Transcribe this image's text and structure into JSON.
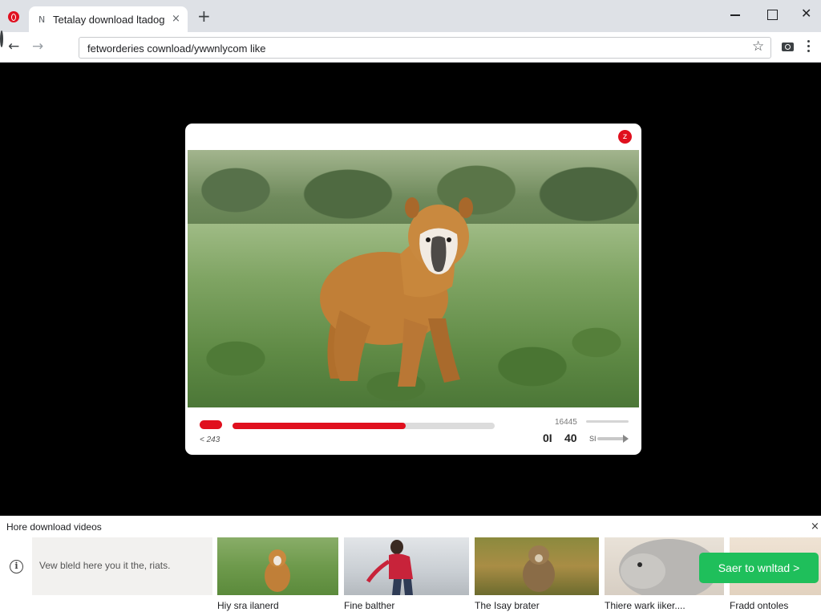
{
  "browser": {
    "tab_favicon": "N",
    "tab_title": "Tetalay download ltadog",
    "tab_close": "×",
    "new_tab": "+",
    "url": "fetworderies cownload/ywwnlycom like",
    "icons": [
      "app-logo-icon",
      "close-icon",
      "plus-icon",
      "minimize-icon",
      "maximize-icon",
      "back-arrow-icon",
      "forward-arrow-icon",
      "reload-icon",
      "star-icon",
      "camera-icon",
      "kebab-menu-icon"
    ],
    "window_close": "✕"
  },
  "player": {
    "close_glyph": "z",
    "progress": 0.66,
    "time_left": "< 243",
    "side_count": "16445",
    "counter_a": "0I",
    "counter_b": "40",
    "side_code": "SI",
    "accent": "#e0101e"
  },
  "download_bar": {
    "title": "Hore download videos",
    "close": "×",
    "info_icon": "i",
    "info_text": "Vew bleld here you it the, riats.",
    "captions": [
      "Hiy sra ilanerd",
      "Fine balther",
      "The Isay brater",
      "Thiere wark iiker....",
      "Fradd ontoles"
    ],
    "cta_label": "Saer to wnltad  >",
    "cta_color": "#1fbf5b"
  }
}
